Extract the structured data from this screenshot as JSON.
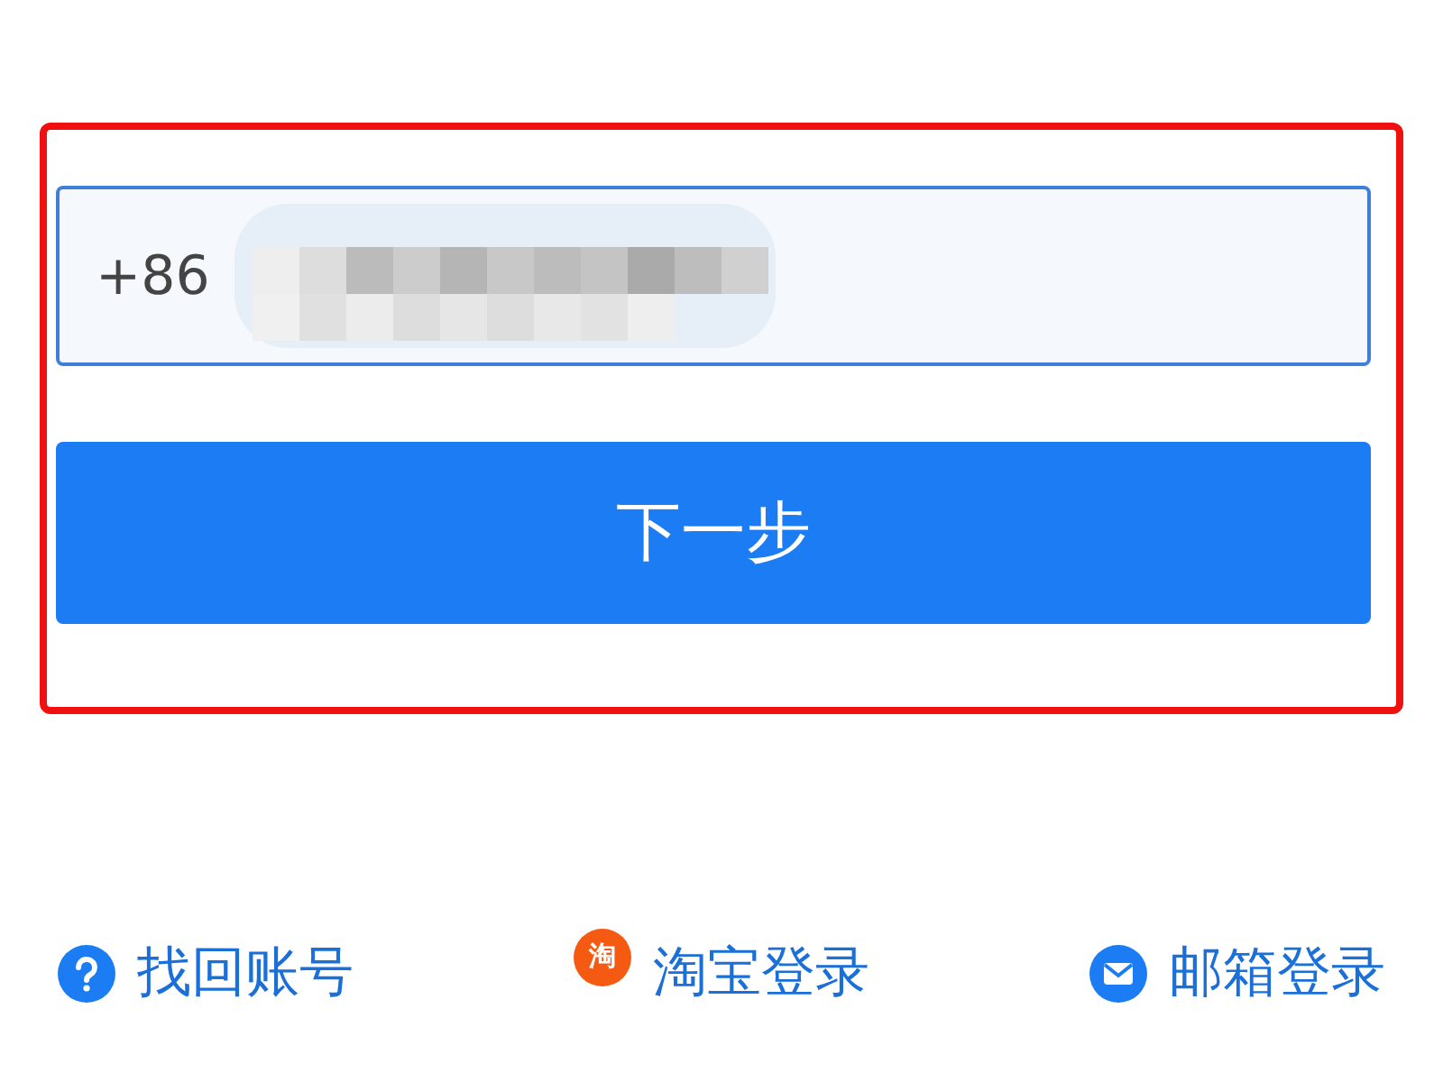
{
  "phone_field": {
    "country_code": "+86"
  },
  "next_button": {
    "label": "下一步"
  },
  "links": [
    {
      "kind": "help",
      "label": "找回账号"
    },
    {
      "kind": "taobao",
      "label": "淘宝登录",
      "icon_text": "淘"
    },
    {
      "kind": "mail",
      "label": "邮箱登录"
    }
  ]
}
